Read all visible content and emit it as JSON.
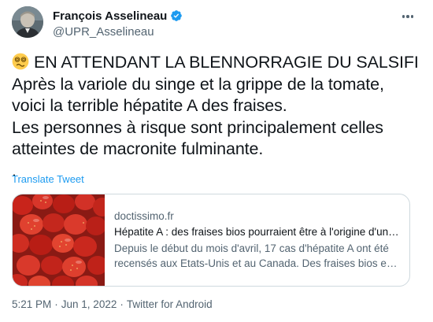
{
  "author": {
    "name": "François Asselineau",
    "handle": "@UPR_Asselineau",
    "verified": true
  },
  "tweet": {
    "emoji_icon": "woozy-face-icon",
    "text": "EN ATTENDANT LA BLENNORRAGIE DU SALSIFI\nAprès la variole du singe et la grippe de la tomate, voici la terrible hépatite A des fraises.\nLes personnes à risque sont principalement celles atteintes de macronite fulminante.\n.",
    "translate_label": "Translate Tweet"
  },
  "card": {
    "domain": "doctissimo.fr",
    "title": "Hépatite A : des fraises bios pourraient être à l'origine d'une épidémie",
    "description_line1": "Depuis le début du mois d'avril, 17 cas d'hépatite A ont été",
    "description_line2": "recensés aux Etats-Unis et au Canada. Des fraises bios en cause"
  },
  "meta": {
    "time": "5:21 PM",
    "sep1": "·",
    "date": "Jun 1, 2022",
    "sep2": "·",
    "source": "Twitter for Android"
  },
  "colors": {
    "link": "#1d9bf0",
    "secondary_text": "#536471",
    "verified_badge": "#1d9bf0"
  }
}
